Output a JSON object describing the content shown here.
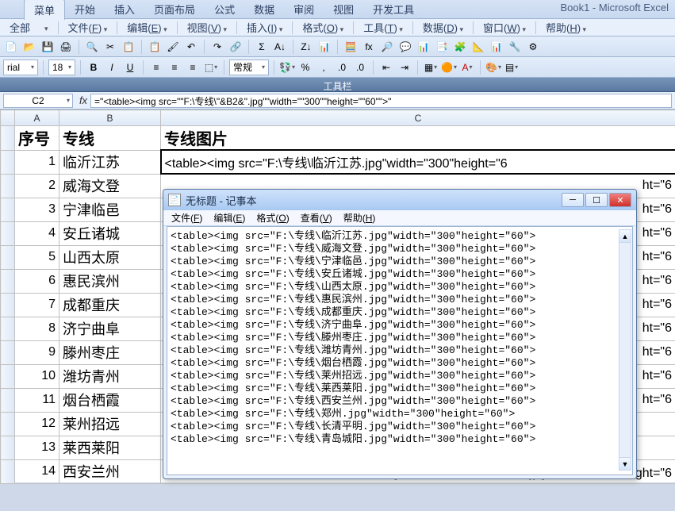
{
  "title_right": "Book1 - Microsoft Excel",
  "ribbon_tabs": [
    "菜单",
    "开始",
    "插入",
    "页面布局",
    "公式",
    "数据",
    "审阅",
    "视图",
    "开发工具"
  ],
  "menu_items": [
    {
      "pre": "全部",
      "label": "▾"
    },
    {
      "label": "文件",
      "u": "F"
    },
    {
      "label": "编辑",
      "u": "E"
    },
    {
      "label": "视图",
      "u": "V"
    },
    {
      "label": "插入",
      "u": "I"
    },
    {
      "label": "格式",
      "u": "O"
    },
    {
      "label": "工具",
      "u": "T"
    },
    {
      "label": "数据",
      "u": "D"
    },
    {
      "label": "窗口",
      "u": "W"
    },
    {
      "label": "帮助",
      "u": "H"
    }
  ],
  "toolbar_icons_row1": [
    "📄",
    "📂",
    "💾",
    "🖨",
    "🔍",
    "✂",
    "📋",
    "📋",
    "🖌",
    "↶",
    "↷",
    "🔗",
    "Σ",
    "A↓",
    "Z↓",
    "📊",
    "🧮",
    "fx",
    "🔎",
    "💬",
    "📊",
    "📑",
    "🧩",
    "📐",
    "📊",
    "🔧",
    "⚙"
  ],
  "font_name": "rial",
  "font_size": "18",
  "style_format": "常规",
  "toolbar_label": "工具栏",
  "namebox": "C2",
  "fx_label": "fx",
  "formula": "=\"<table><img src=\"\"F:\\专线\\\"&B2&\".jpg\"\"width=\"\"300\"\"height=\"\"60\"\">\"",
  "col_headers": [
    "",
    "A",
    "B",
    "C"
  ],
  "header_row": {
    "A": "序号",
    "B": "专线",
    "C": "专线图片"
  },
  "rows": [
    {
      "n": "1",
      "b": "临沂江苏",
      "c": "<table><img src=\"F:\\专线\\临沂江苏.jpg\"width=\"300\"height=\"6"
    },
    {
      "n": "2",
      "b": "威海文登",
      "c": "ht=\"6"
    },
    {
      "n": "3",
      "b": "宁津临邑",
      "c": "ht=\"6"
    },
    {
      "n": "4",
      "b": "安丘诸城",
      "c": "ht=\"6"
    },
    {
      "n": "5",
      "b": "山西太原",
      "c": "ht=\"6"
    },
    {
      "n": "6",
      "b": "惠民滨州",
      "c": "ht=\"6"
    },
    {
      "n": "7",
      "b": "成都重庆",
      "c": "ht=\"6"
    },
    {
      "n": "8",
      "b": "济宁曲阜",
      "c": "ht=\"6"
    },
    {
      "n": "9",
      "b": "滕州枣庄",
      "c": "ht=\"6"
    },
    {
      "n": "10",
      "b": "潍坊青州",
      "c": "ht=\"6"
    },
    {
      "n": "11",
      "b": "烟台栖霞",
      "c": "ht=\"6"
    },
    {
      "n": "12",
      "b": "莱州招远",
      "c": ""
    },
    {
      "n": "13",
      "b": "莱西莱阳",
      "c": ""
    },
    {
      "n": "14",
      "b": "西安兰州",
      "c": "<table><img src=\"F:\\专线\\西安兰州.jpg\"width=\"300\"height=\"6"
    }
  ],
  "notepad": {
    "title": "无标题 - 记事本",
    "menu": [
      {
        "label": "文件",
        "u": "F"
      },
      {
        "label": "编辑",
        "u": "E"
      },
      {
        "label": "格式",
        "u": "O"
      },
      {
        "label": "查看",
        "u": "V"
      },
      {
        "label": "帮助",
        "u": "H"
      }
    ],
    "lines": [
      "<table><img src=\"F:\\专线\\临沂江苏.jpg\"width=\"300\"height=\"60\">",
      "<table><img src=\"F:\\专线\\威海文登.jpg\"width=\"300\"height=\"60\">",
      "<table><img src=\"F:\\专线\\宁津临邑.jpg\"width=\"300\"height=\"60\">",
      "<table><img src=\"F:\\专线\\安丘诸城.jpg\"width=\"300\"height=\"60\">",
      "<table><img src=\"F:\\专线\\山西太原.jpg\"width=\"300\"height=\"60\">",
      "<table><img src=\"F:\\专线\\惠民滨州.jpg\"width=\"300\"height=\"60\">",
      "<table><img src=\"F:\\专线\\成都重庆.jpg\"width=\"300\"height=\"60\">",
      "<table><img src=\"F:\\专线\\济宁曲阜.jpg\"width=\"300\"height=\"60\">",
      "<table><img src=\"F:\\专线\\滕州枣庄.jpg\"width=\"300\"height=\"60\">",
      "<table><img src=\"F:\\专线\\潍坊青州.jpg\"width=\"300\"height=\"60\">",
      "<table><img src=\"F:\\专线\\烟台栖霞.jpg\"width=\"300\"height=\"60\">",
      "<table><img src=\"F:\\专线\\莱州招远.jpg\"width=\"300\"height=\"60\">",
      "<table><img src=\"F:\\专线\\莱西莱阳.jpg\"width=\"300\"height=\"60\">",
      "<table><img src=\"F:\\专线\\西安兰州.jpg\"width=\"300\"height=\"60\">",
      "<table><img src=\"F:\\专线\\郑州.jpg\"width=\"300\"height=\"60\">",
      "<table><img src=\"F:\\专线\\长清平明.jpg\"width=\"300\"height=\"60\">",
      "<table><img src=\"F:\\专线\\青岛城阳.jpg\"width=\"300\"height=\"60\">"
    ]
  }
}
